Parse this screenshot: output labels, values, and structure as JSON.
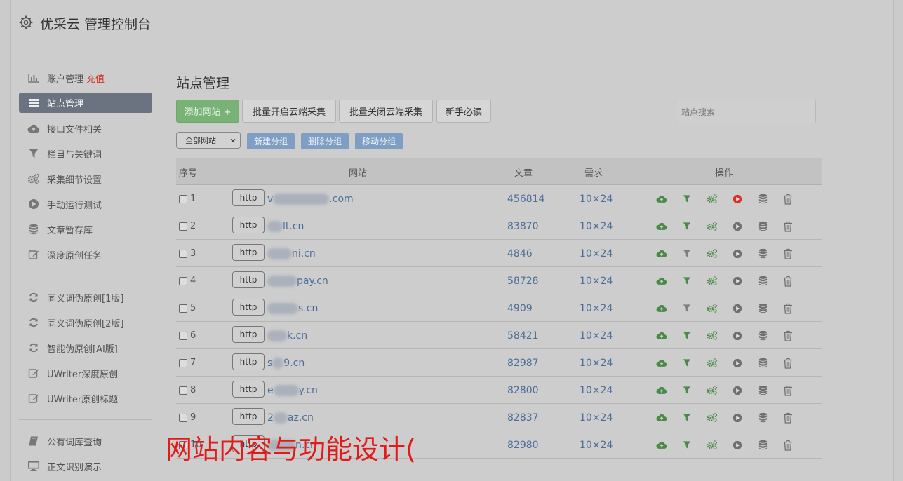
{
  "header": {
    "title": "优采云 管理控制台"
  },
  "sidebar": {
    "group1": [
      {
        "label": "账户管理",
        "extra": "充值",
        "icon": "bar-chart-icon"
      },
      {
        "label": "站点管理",
        "icon": "server-icon",
        "active": true
      },
      {
        "label": "接口文件相关",
        "icon": "cloud-upload-icon"
      },
      {
        "label": "栏目与关键词",
        "icon": "filter-icon"
      },
      {
        "label": "采集细节设置",
        "icon": "gears-icon"
      },
      {
        "label": "手动运行测试",
        "icon": "play-icon"
      },
      {
        "label": "文章暂存库",
        "icon": "database-icon"
      },
      {
        "label": "深度原创任务",
        "icon": "edit-icon"
      }
    ],
    "group2": [
      {
        "label": "同义词伪原创[1版]",
        "icon": "refresh-icon"
      },
      {
        "label": "同义词伪原创[2版]",
        "icon": "refresh-icon"
      },
      {
        "label": "智能伪原创[AI版]",
        "icon": "refresh-icon"
      },
      {
        "label": "UWriter深度原创",
        "icon": "edit-icon"
      },
      {
        "label": "UWriter原创标题",
        "icon": "edit-icon"
      }
    ],
    "group3": [
      {
        "label": "公有词库查询",
        "icon": "book-icon"
      },
      {
        "label": "正文识别演示",
        "icon": "monitor-icon"
      }
    ]
  },
  "main": {
    "title": "站点管理",
    "buttons": {
      "add": "添加网站 +",
      "batch_on": "批量开启云端采集",
      "batch_off": "批量关闭云端采集",
      "guide": "新手必读"
    },
    "search_placeholder": "站点搜索",
    "group_select": "全部网站",
    "group_buttons": {
      "new": "新建分组",
      "delete": "删除分组",
      "move": "移动分组"
    },
    "table": {
      "headers": {
        "index": "序号",
        "site": "网站",
        "articles": "文章",
        "demand": "需求",
        "ops": "操作"
      },
      "http_label": "http",
      "rows": [
        {
          "index": "1",
          "prefix": "v",
          "suffix": ".com",
          "blur_w": 80,
          "articles": "456814",
          "demand": "10×24",
          "play_active": true,
          "filter_active": true
        },
        {
          "index": "2",
          "prefix": "",
          "suffix": "lt.cn",
          "blur_w": 22,
          "articles": "83870",
          "demand": "10×24",
          "play_active": false,
          "filter_active": true
        },
        {
          "index": "3",
          "prefix": "",
          "suffix": "ni.cn",
          "blur_w": 35,
          "articles": "4846",
          "demand": "10×24",
          "play_active": false,
          "filter_active": false
        },
        {
          "index": "4",
          "prefix": "",
          "suffix": "pay.cn",
          "blur_w": 42,
          "articles": "58728",
          "demand": "10×24",
          "play_active": false,
          "filter_active": true
        },
        {
          "index": "5",
          "prefix": "",
          "suffix": "s.cn",
          "blur_w": 44,
          "articles": "4909",
          "demand": "10×24",
          "play_active": false,
          "filter_active": false
        },
        {
          "index": "6",
          "prefix": "",
          "suffix": "k.cn",
          "blur_w": 28,
          "articles": "58421",
          "demand": "10×24",
          "play_active": false,
          "filter_active": true
        },
        {
          "index": "7",
          "prefix": "s",
          "suffix": "9.cn",
          "blur_w": 16,
          "articles": "82987",
          "demand": "10×24",
          "play_active": false,
          "filter_active": true
        },
        {
          "index": "8",
          "prefix": "e",
          "suffix": "y.cn",
          "blur_w": 36,
          "articles": "82800",
          "demand": "10×24",
          "play_active": false,
          "filter_active": true
        },
        {
          "index": "9",
          "prefix": "2",
          "suffix": "az.cn",
          "blur_w": 20,
          "articles": "82837",
          "demand": "10×24",
          "play_active": false,
          "filter_active": true
        },
        {
          "index": "10",
          "prefix": "",
          "suffix": "n.cn",
          "blur_w": 40,
          "articles": "82980",
          "demand": "10×24",
          "play_active": false,
          "filter_active": true
        }
      ]
    }
  },
  "overlay_text": "网站内容与功能设计(",
  "colors": {
    "green": "#4a8a47",
    "red": "#d9302a",
    "link": "#4b6f98",
    "gray_icon": "#6f6f6f"
  }
}
